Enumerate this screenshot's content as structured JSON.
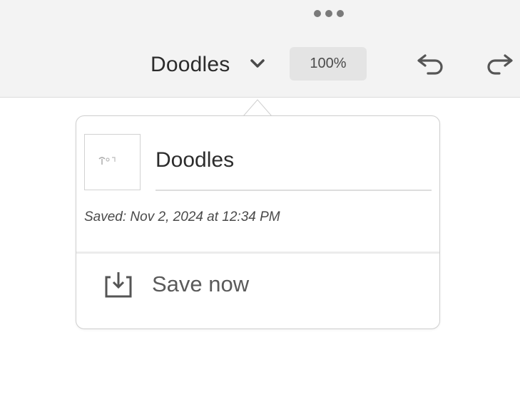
{
  "toolbar": {
    "more_icon": "more-horizontal-icon",
    "document_title": "Doodles",
    "title_dropdown_icon": "chevron-down-icon",
    "zoom_level": "100%",
    "undo_icon": "undo-icon",
    "redo_icon": "redo-icon"
  },
  "popover": {
    "document_name": "Doodles",
    "saved_status": "Saved: Nov 2, 2024 at 12:34 PM",
    "save_now_label": "Save now",
    "save_now_icon": "save-download-icon"
  },
  "colors": {
    "toolbar_bg": "#f3f3f3",
    "zoom_bg": "#e4e4e4",
    "text_primary": "#2c2c2c",
    "text_secondary": "#5a5a5a"
  }
}
